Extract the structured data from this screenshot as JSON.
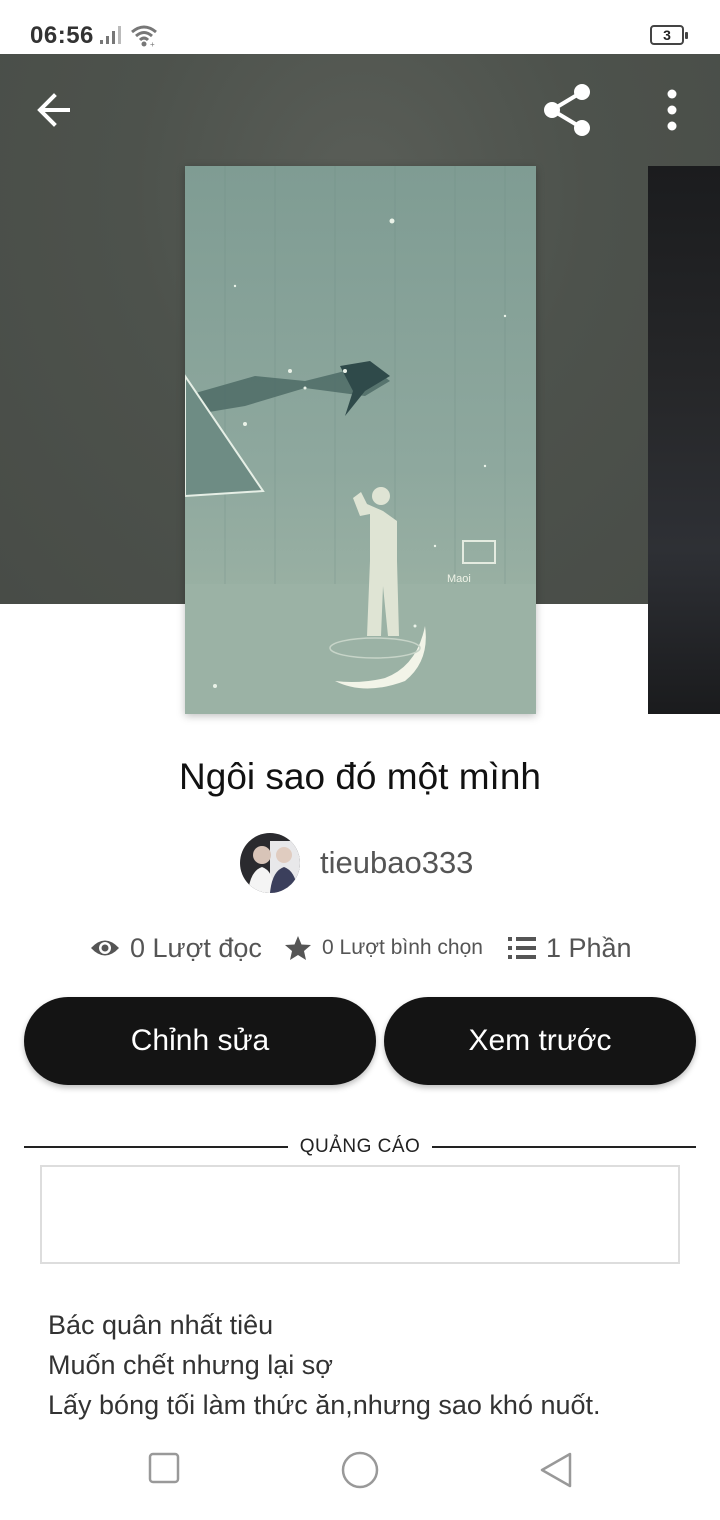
{
  "status_bar": {
    "time": "06:56",
    "battery": "3",
    "icons": [
      "signal-icon",
      "wifi-icon",
      "battery-icon"
    ]
  },
  "header": {
    "background_color": "#4d524c",
    "icons": [
      "back-arrow-icon",
      "share-icon",
      "more-vertical-icon"
    ]
  },
  "cover": {
    "signature_text": "Maoi",
    "palette": [
      "#8fa9a0",
      "#5e7a72",
      "#dfe8e0"
    ]
  },
  "story": {
    "title": "Ngôi sao đó một mình",
    "author": "tieubao333"
  },
  "stats": {
    "reads": "0 Lượt đọc",
    "votes": "0 Lượt bình chọn",
    "parts": "1 Phần"
  },
  "actions": {
    "edit_label": "Chỉnh sửa",
    "preview_label": "Xem trước"
  },
  "ad": {
    "label": "QUẢNG CÁO"
  },
  "description": {
    "lines": [
      "Bác quân nhất tiêu",
      "Muốn chết nhưng lại sợ",
      "Lấy bóng tối làm thức ăn,nhưng sao khó nuốt."
    ]
  },
  "nav_bar": {
    "icons": [
      "recent-apps-icon",
      "home-icon",
      "back-triangle-icon"
    ]
  }
}
